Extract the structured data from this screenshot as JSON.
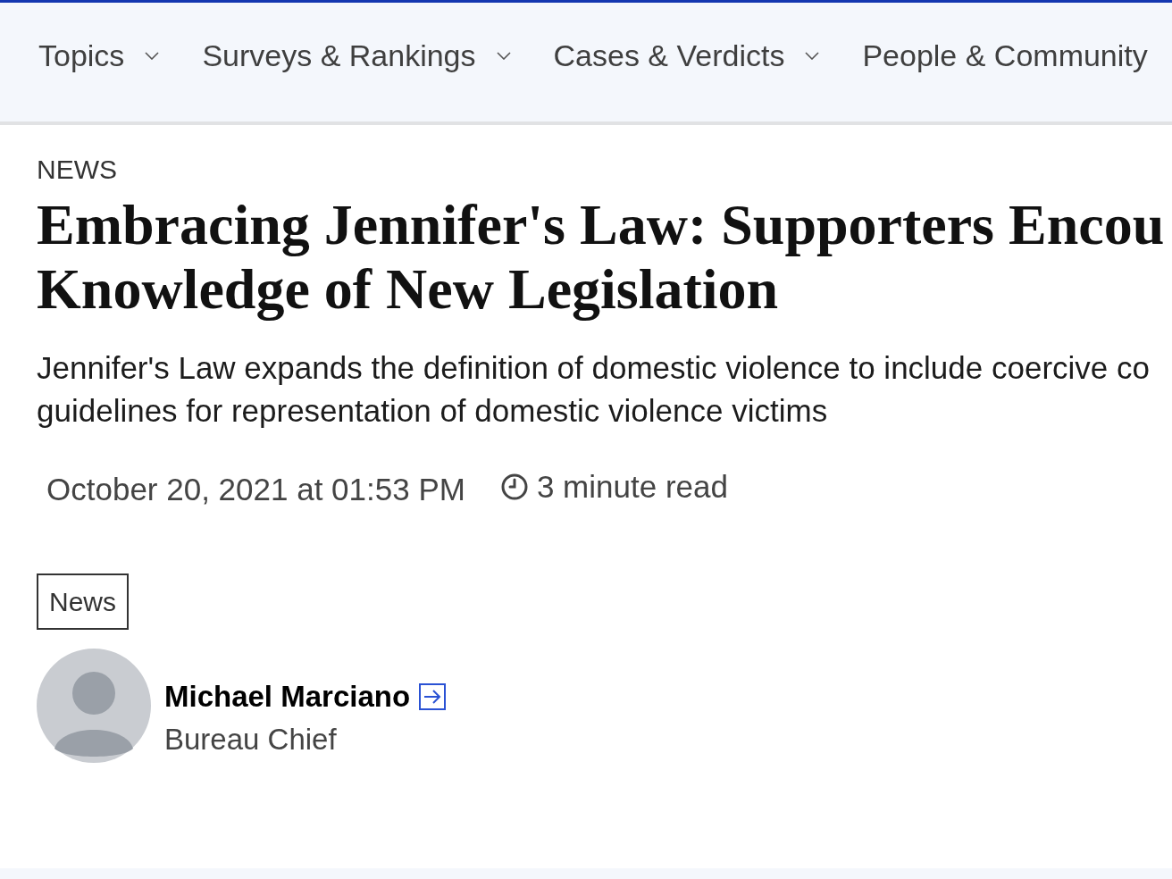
{
  "nav": {
    "items": [
      {
        "label": "Topics",
        "dropdown": true
      },
      {
        "label": "Surveys & Rankings",
        "dropdown": true
      },
      {
        "label": "Cases & Verdicts",
        "dropdown": true
      },
      {
        "label": "People & Community",
        "dropdown": false
      }
    ]
  },
  "article": {
    "section": "NEWS",
    "title_lines": [
      "Embracing Jennifer's Law: Supporters Encou",
      "Knowledge of New Legislation"
    ],
    "dek_lines": [
      "Jennifer's Law expands the definition of domestic violence to include coercive co",
      "guidelines for representation of domestic violence victims"
    ],
    "date": "October 20, 2021 at 01:53 PM",
    "read_time": "3 minute read",
    "tags": [
      "News"
    ],
    "author": {
      "name": "Michael Marciano",
      "role": "Bureau Chief"
    }
  }
}
